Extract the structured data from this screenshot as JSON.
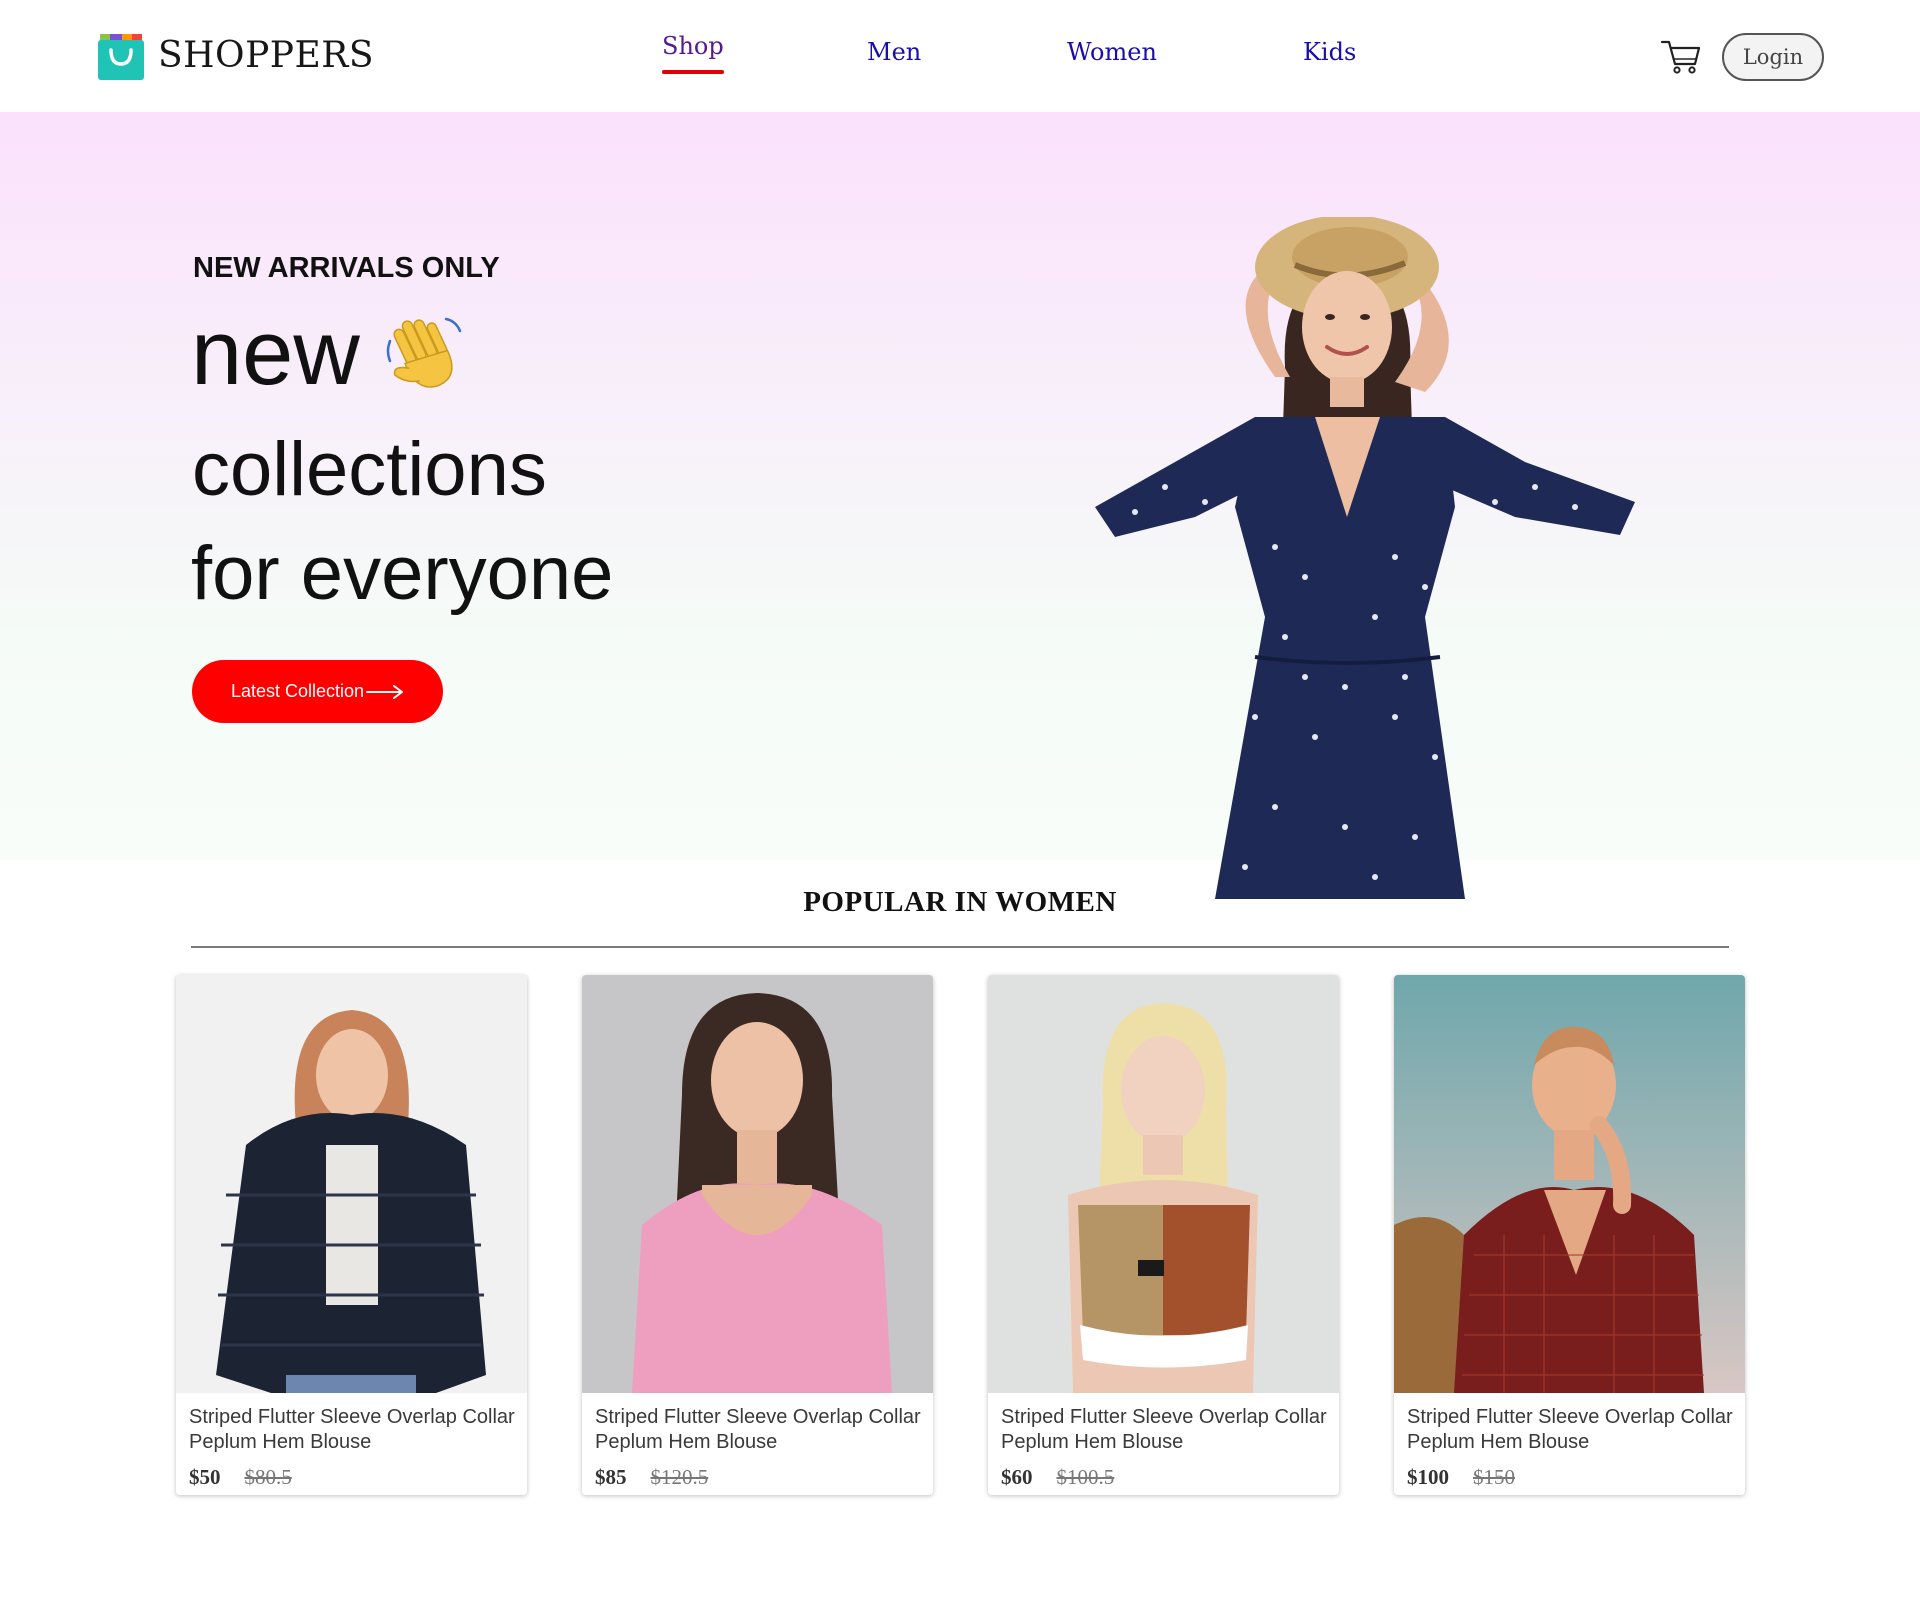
{
  "brand": {
    "name": "SHOPPERS",
    "logo_icon": "shopping-bag-icon",
    "logo_color": "#1fc4b6"
  },
  "nav": {
    "items": [
      {
        "label": "Shop",
        "active": true
      },
      {
        "label": "Men",
        "active": false
      },
      {
        "label": "Women",
        "active": false
      },
      {
        "label": "Kids",
        "active": false
      }
    ],
    "active_underline_color": "#e00000",
    "cart_icon": "cart-icon",
    "login_label": "Login"
  },
  "hero": {
    "tagline": "NEW ARRIVALS ONLY",
    "line1": "new",
    "hand_icon": "waving-hand-icon",
    "line2": "collections",
    "line3": "for everyone",
    "cta_label": "Latest Collection",
    "cta_icon": "arrow-right-icon",
    "cta_color": "#ff0000"
  },
  "popular": {
    "title": "POPULAR IN WOMEN",
    "products": [
      {
        "name": "Striped Flutter Sleeve Overlap Collar Peplum Hem Blouse",
        "new_price": "$50",
        "old_price": "$80.5"
      },
      {
        "name": "Striped Flutter Sleeve Overlap Collar Peplum Hem Blouse",
        "new_price": "$85",
        "old_price": "$120.5"
      },
      {
        "name": "Striped Flutter Sleeve Overlap Collar Peplum Hem Blouse",
        "new_price": "$60",
        "old_price": "$100.5"
      },
      {
        "name": "Striped Flutter Sleeve Overlap Collar Peplum Hem Blouse",
        "new_price": "$100",
        "old_price": "$150"
      }
    ]
  }
}
